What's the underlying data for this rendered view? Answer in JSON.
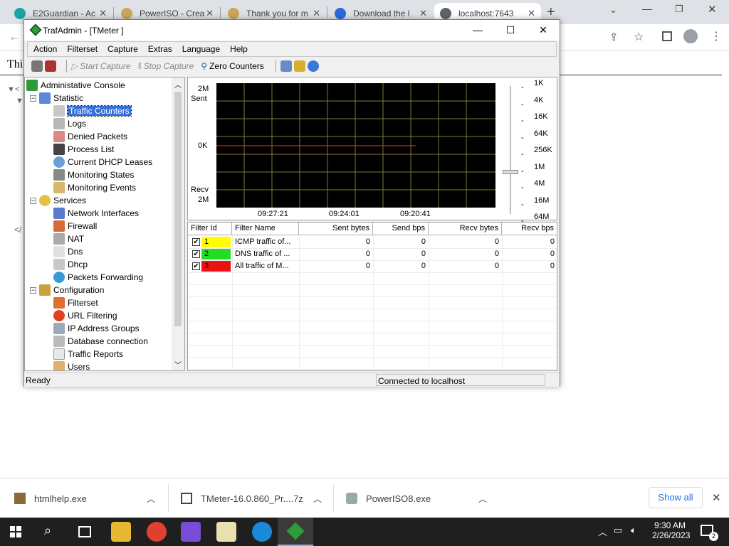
{
  "browser": {
    "tabs": [
      {
        "title": "E2Guardian - Ac",
        "color": "#1aa3a3"
      },
      {
        "title": "PowerISO - Crea",
        "color": "#c9a85c"
      },
      {
        "title": "Thank you for m",
        "color": "#c9a85c"
      },
      {
        "title": "Download the l",
        "color": "#2a6ad8"
      },
      {
        "title": "localhost:7643",
        "color": "#5f6368"
      }
    ],
    "page_text_fragment": "Thi",
    "page_marker_1": "▼<",
    "page_marker_2": "</"
  },
  "window": {
    "title": "TrafAdmin - [TMeter ]",
    "menu": [
      "Action",
      "Filterset",
      "Capture",
      "Extras",
      "Language",
      "Help"
    ],
    "toolbar": {
      "start_capture": "Start Capture",
      "stop_capture": "Stop Capture",
      "zero_counters": "Zero Counters"
    },
    "tree": {
      "root": "Administative Console",
      "statistic": "Statistic",
      "statistic_items": [
        "Traffic Counters",
        "Logs",
        "Denied Packets",
        "Process List",
        "Current DHCP Leases",
        "Monitoring States",
        "Monitoring Events"
      ],
      "services": "Services",
      "services_items": [
        "Network Interfaces",
        "Firewall",
        "NAT",
        "Dns",
        "Dhcp",
        "Packets Forwarding"
      ],
      "configuration": "Configuration",
      "configuration_items": [
        "Filterset",
        "URL Filtering",
        "IP Address Groups",
        "Database connection",
        "Traffic Reports",
        "Users"
      ]
    },
    "graph": {
      "top_label": "2M",
      "sent_label": "Sent",
      "zero_label": "0K",
      "recv_label": "Recv",
      "bottom_label": "2M",
      "time_labels": [
        "09:27:21",
        "09:24:01",
        "09:20:41"
      ],
      "scale_labels": [
        "1K",
        "4K",
        "16K",
        "64K",
        "256K",
        "1M",
        "4M",
        "16M",
        "64M"
      ]
    },
    "table": {
      "headers": [
        "Filter Id",
        "Filter Name",
        "Sent bytes",
        "Send bps",
        "Recv bytes",
        "Recv bps"
      ],
      "rows": [
        {
          "id": "1",
          "color": "#ffff00",
          "name": "ICMP traffic of...",
          "sent": "0",
          "sendbps": "0",
          "recv": "0",
          "recvbps": "0"
        },
        {
          "id": "2",
          "color": "#22dd22",
          "name": "DNS traffic of ...",
          "sent": "0",
          "sendbps": "0",
          "recv": "0",
          "recvbps": "0"
        },
        {
          "id": "3",
          "color": "#ee1111",
          "name": "All traffic of M...",
          "sent": "0",
          "sendbps": "0",
          "recv": "0",
          "recvbps": "0"
        }
      ]
    },
    "status": {
      "left": "Ready",
      "right": "Connected to localhost"
    }
  },
  "downloads": {
    "items": [
      "htmlhelp.exe",
      "TMeter-16.0.860_Pr....7z",
      "PowerISO8.exe"
    ],
    "show_all": "Show all"
  },
  "taskbar": {
    "time": "9:30 AM",
    "date": "2/26/2023",
    "notif_count": "2"
  }
}
